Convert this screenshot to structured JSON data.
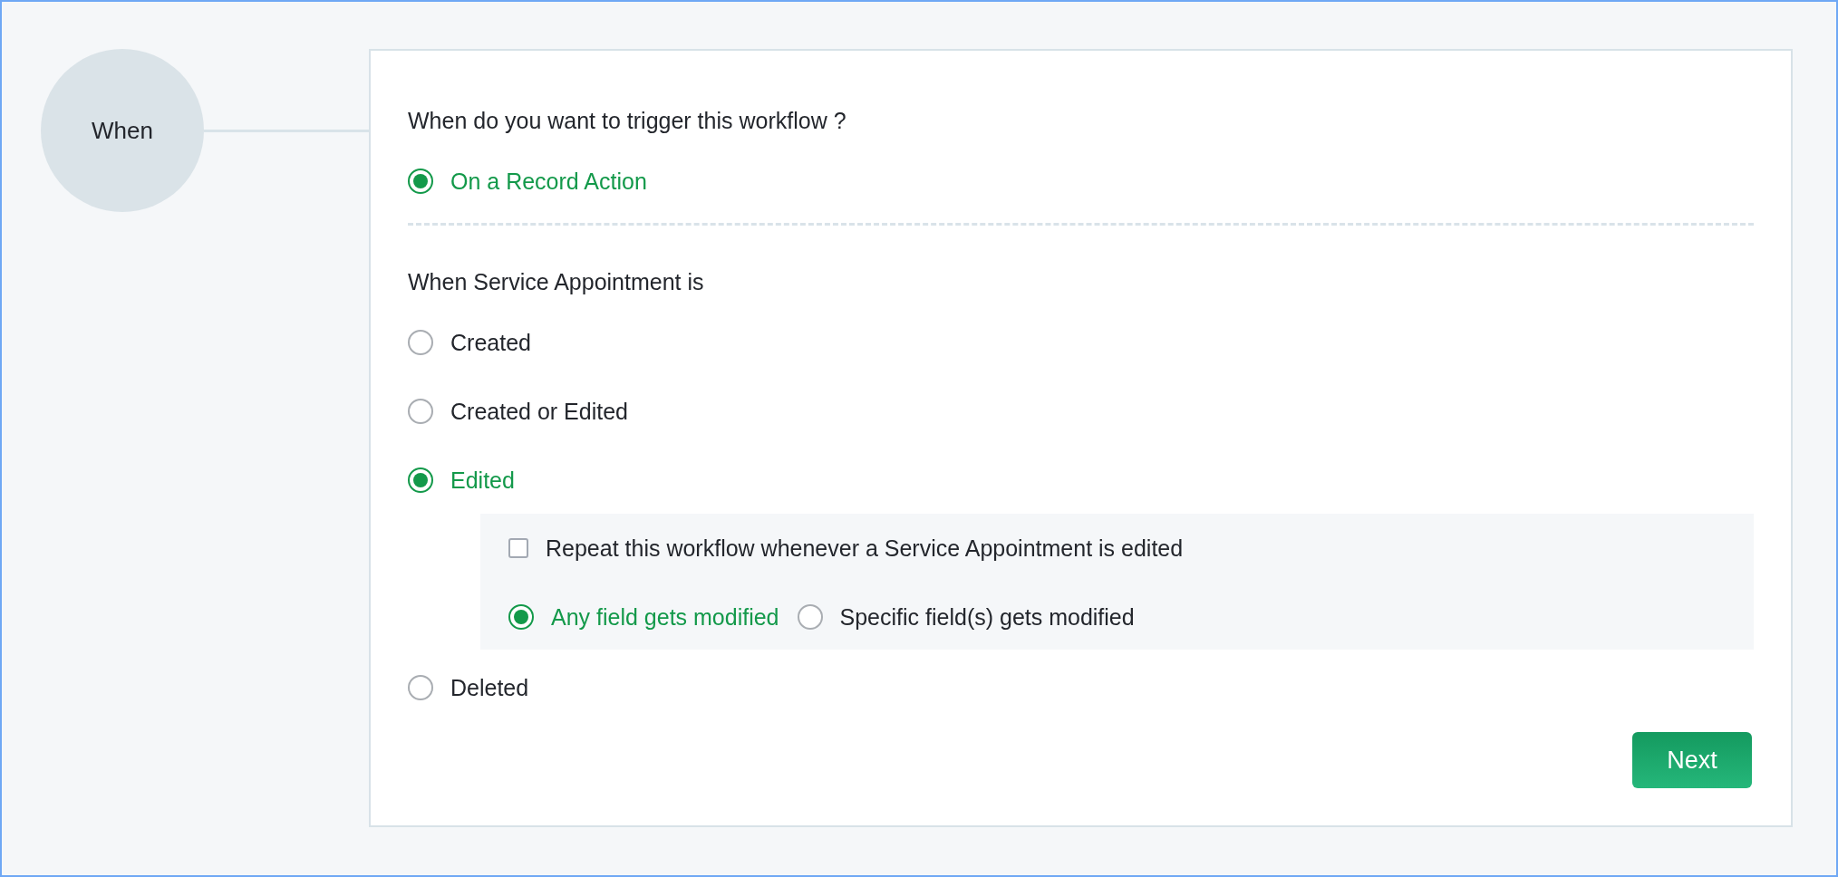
{
  "step": {
    "label": "When"
  },
  "question": "When do you want to trigger this workflow ?",
  "trigger_options": [
    {
      "label": "On a Record Action",
      "selected": true
    }
  ],
  "condition_heading": "When Service Appointment is",
  "conditions": [
    {
      "label": "Created",
      "selected": false
    },
    {
      "label": "Created or Edited",
      "selected": false
    },
    {
      "label": "Edited",
      "selected": true,
      "repeat": {
        "label": "Repeat this workflow whenever a Service Appointment is edited",
        "checked": false
      },
      "modes": [
        {
          "label": "Any field gets modified",
          "selected": true
        },
        {
          "label": "Specific field(s) gets modified",
          "selected": false
        }
      ]
    },
    {
      "label": "Deleted",
      "selected": false
    }
  ],
  "next_button": "Next"
}
